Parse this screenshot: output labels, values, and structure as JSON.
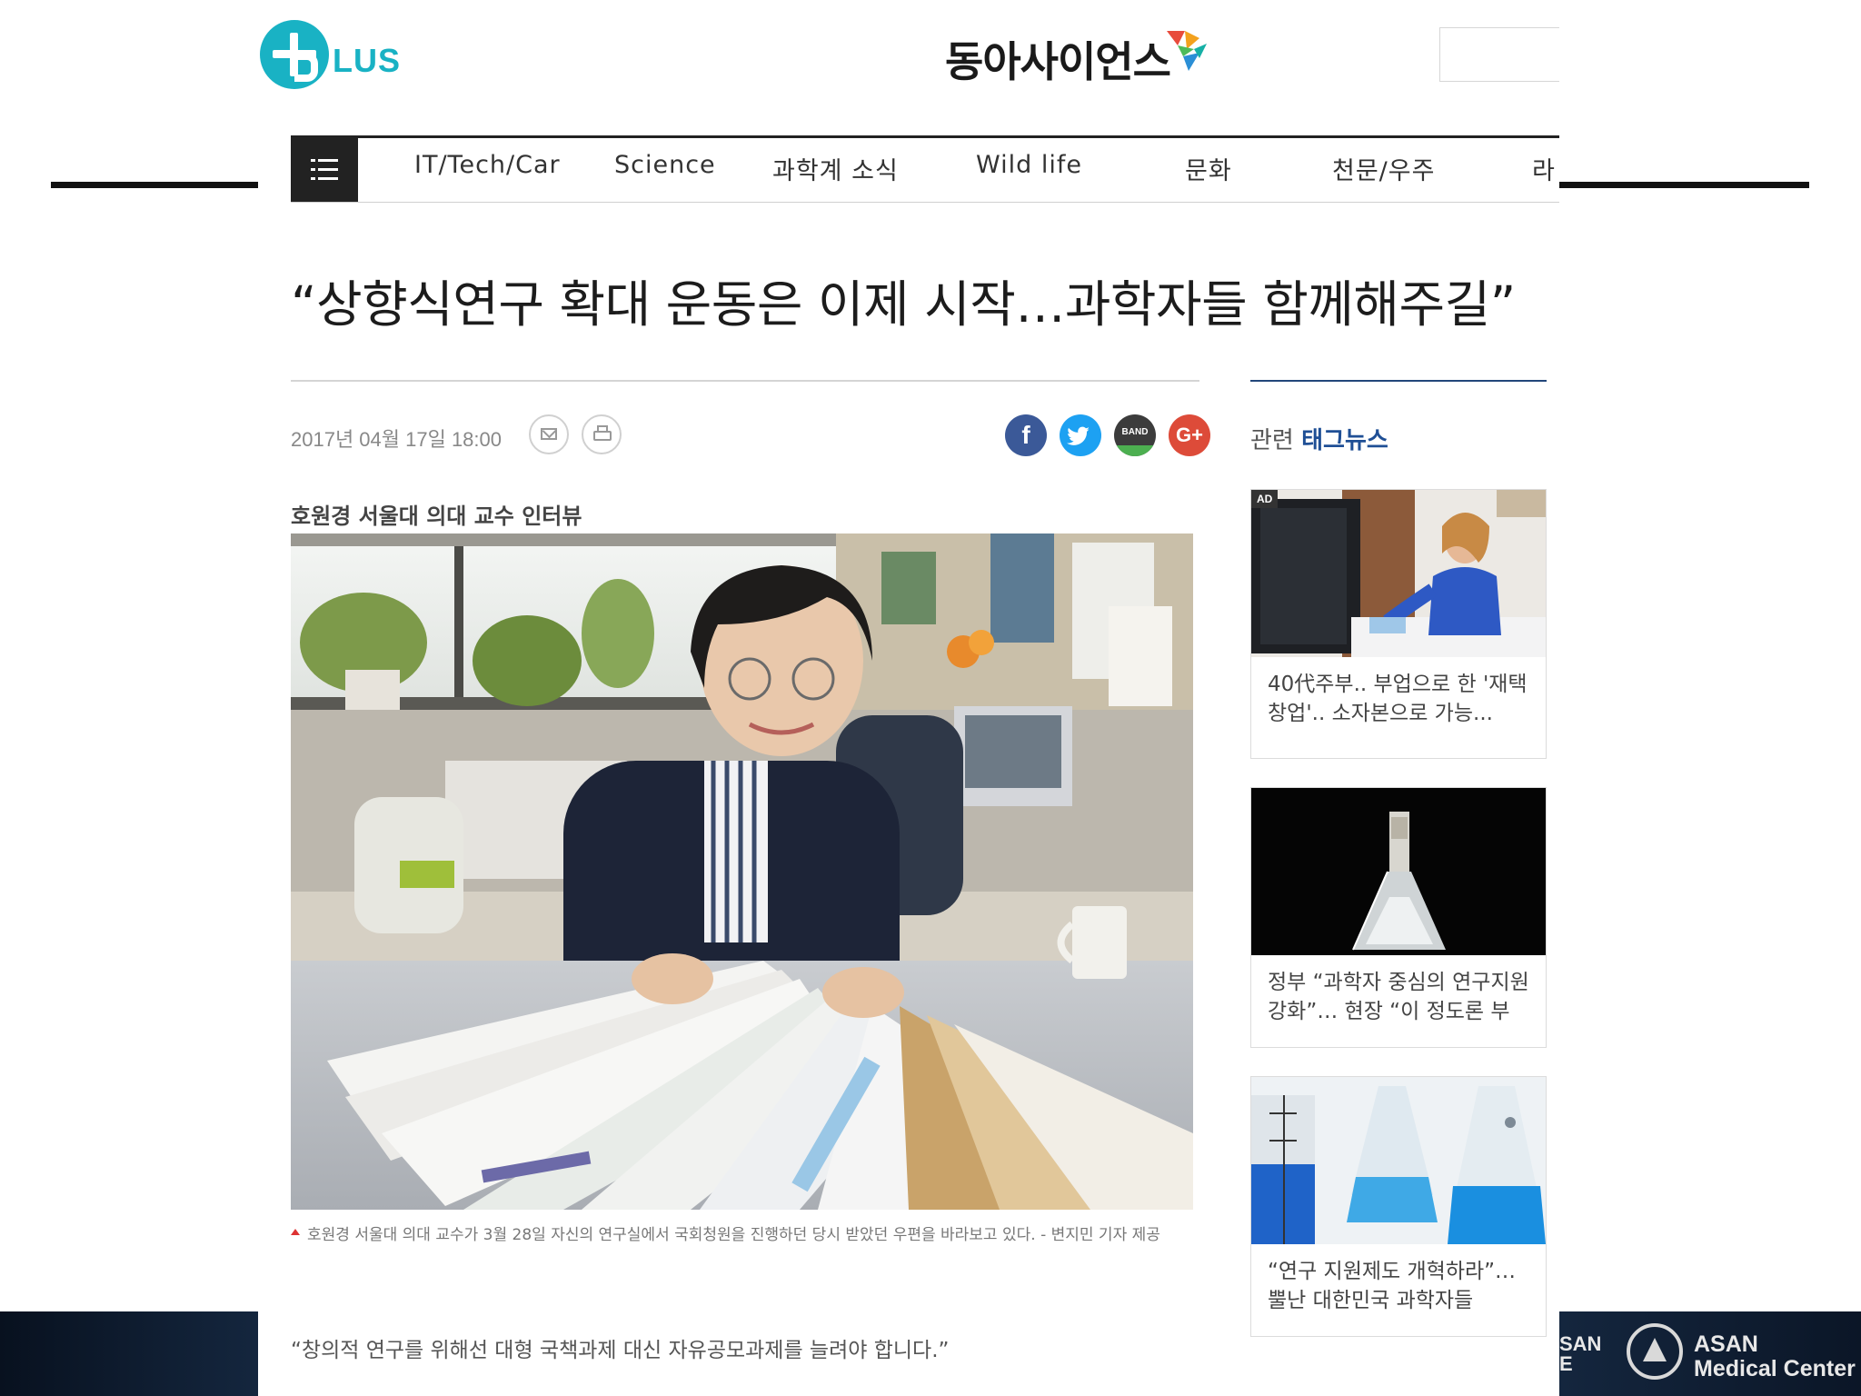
{
  "site": {
    "plus_logo_text": "LUS",
    "brand_name": "동아사이언스"
  },
  "nav": {
    "items": [
      "IT/Tech/Car",
      "Science",
      "과학계 소식",
      "Wild life",
      "문화",
      "천문/우주",
      "라"
    ]
  },
  "article": {
    "headline": "“상향식연구 확대 운동은 이제 시작…과학자들 함께해주길”",
    "date": "2017년 04월 17일 18:00",
    "subhead": "호원경 서울대 의대 교수 인터뷰",
    "caption": "호원경 서울대 의대 교수가 3월 28일 자신의 연구실에서 국회청원을 진행하던 당시 받았던 우편을 바라보고 있다. - 변지민 기자 제공",
    "quote": "“창의적 연구를 위해선 대형 국책과제 대신 자유공모과제를 늘려야 합니다.”"
  },
  "share": {
    "icons": [
      "facebook-icon",
      "twitter-icon",
      "band-icon",
      "google-plus-icon"
    ],
    "facebook_label": "f",
    "band_label": "BAND",
    "google_label": "G+"
  },
  "sidebar": {
    "title_prefix": "관련",
    "title_highlight": "태그뉴스",
    "cards": [
      {
        "badge": "AD",
        "text": "40代주부.. 부업으로 한 '재택창업'.. 소자본으로 가능..."
      },
      {
        "text": "정부 “과학자 중심의 연구지원 강화”… 현장 “이 정도론 부"
      },
      {
        "text": "“연구 지원제도 개혁하라”… 뿔난 대한민국 과학자들"
      }
    ]
  },
  "slide_footer": {
    "partial_text_line1": "SAN",
    "partial_text_line2": "E",
    "org_line1": "ASAN",
    "org_line2": "Medical Center"
  },
  "colors": {
    "plus_teal": "#19b2c4",
    "sidebar_accent": "#1f4f95",
    "facebook": "#3b5998",
    "twitter": "#1da1f2",
    "band": "#3c3c3c",
    "google_plus": "#dd4b39"
  }
}
